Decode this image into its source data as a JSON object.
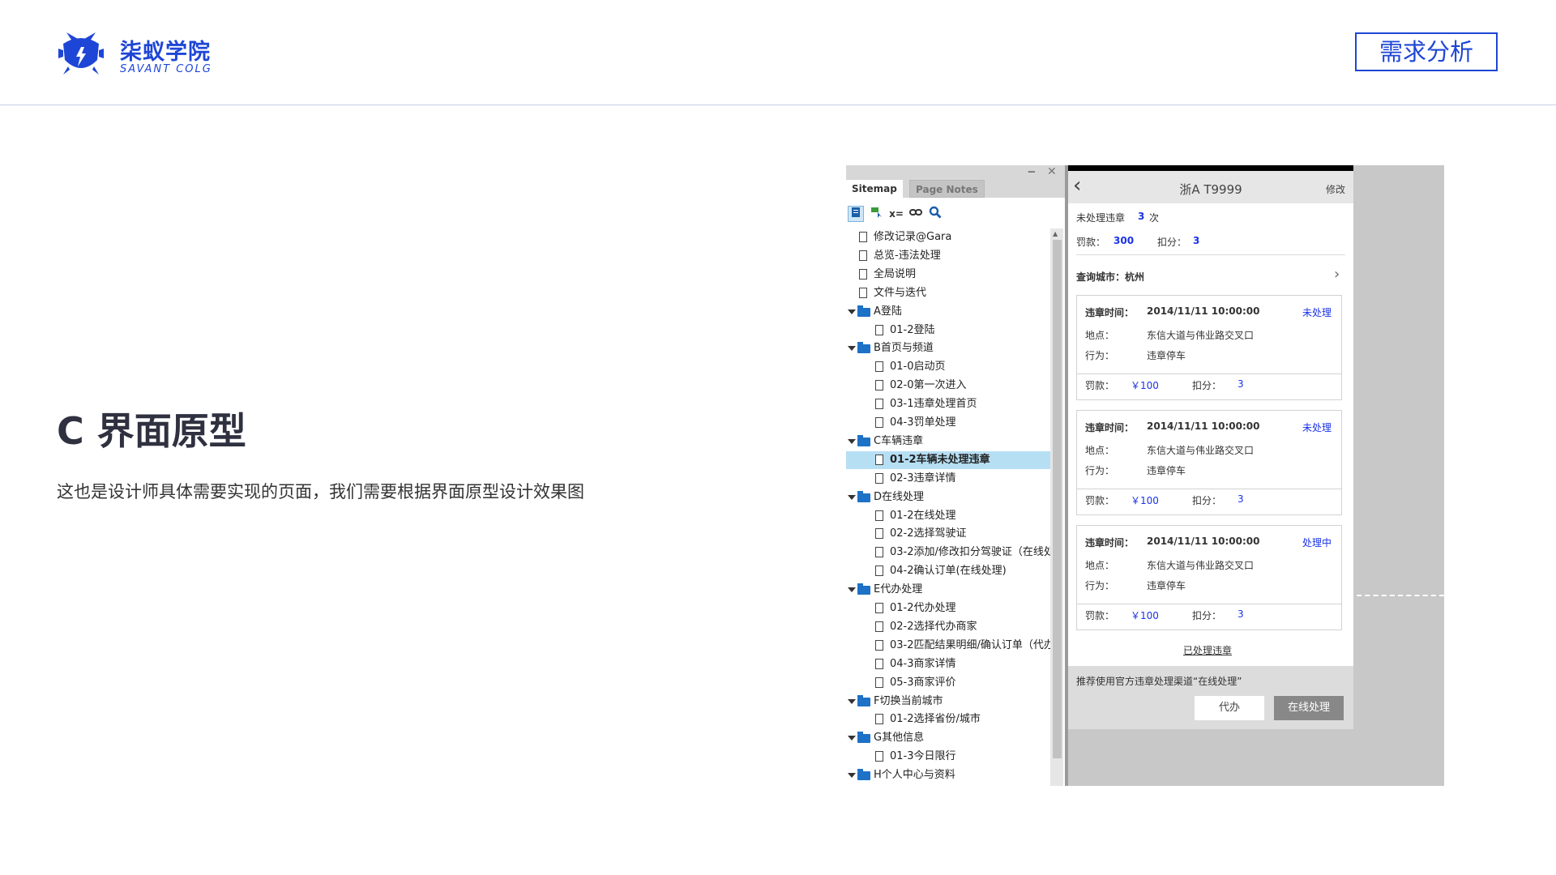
{
  "brand": {
    "name_cn": "柒蚁学院",
    "name_en": "SAVANT COLG",
    "color": "#1e46d6"
  },
  "header": {
    "tag": "需求分析"
  },
  "section": {
    "title": "C 界面原型",
    "subtitle": "这也是设计师具体需要实现的页面，我们需要根据界面原型设计效果图"
  },
  "sitemap": {
    "tabs": [
      "Sitemap",
      "Page Notes"
    ],
    "window_buttons": [
      "‒",
      "✕"
    ],
    "tools": [
      "page-icon",
      "flow-icon",
      "x= variables-icon",
      "link-icon",
      "search-icon"
    ],
    "tool_glyph_variables": "x=",
    "items": [
      {
        "label": "修改记录@Gara",
        "type": "page",
        "level": 0
      },
      {
        "label": "总览-违法处理",
        "type": "page",
        "level": 0
      },
      {
        "label": "全局说明",
        "type": "page",
        "level": 0
      },
      {
        "label": "文件与迭代",
        "type": "page",
        "level": 0
      },
      {
        "label": "A登陆",
        "type": "folder",
        "level": 0
      },
      {
        "label": "01-2登陆",
        "type": "page",
        "level": 1
      },
      {
        "label": "B首页与频道",
        "type": "folder",
        "level": 0
      },
      {
        "label": "01-0启动页",
        "type": "page",
        "level": 1
      },
      {
        "label": "02-0第一次进入",
        "type": "page",
        "level": 1
      },
      {
        "label": "03-1违章处理首页",
        "type": "page",
        "level": 1
      },
      {
        "label": "04-3罚单处理",
        "type": "page",
        "level": 1
      },
      {
        "label": "C车辆违章",
        "type": "folder",
        "level": 0
      },
      {
        "label": "01-2车辆未处理违章",
        "type": "page",
        "level": 1,
        "selected": true
      },
      {
        "label": "02-3违章详情",
        "type": "page",
        "level": 1
      },
      {
        "label": "D在线处理",
        "type": "folder",
        "level": 0
      },
      {
        "label": "01-2在线处理",
        "type": "page",
        "level": 1
      },
      {
        "label": "02-2选择驾驶证",
        "type": "page",
        "level": 1
      },
      {
        "label": "03-2添加/修改扣分驾驶证（在线处",
        "type": "page",
        "level": 1
      },
      {
        "label": "04-2确认订单(在线处理)",
        "type": "page",
        "level": 1
      },
      {
        "label": "E代办处理",
        "type": "folder",
        "level": 0
      },
      {
        "label": "01-2代办处理",
        "type": "page",
        "level": 1
      },
      {
        "label": "02-2选择代办商家",
        "type": "page",
        "level": 1
      },
      {
        "label": "03-2匹配结果明细/确认订单（代办",
        "type": "page",
        "level": 1
      },
      {
        "label": "04-3商家详情",
        "type": "page",
        "level": 1
      },
      {
        "label": "05-3商家评价",
        "type": "page",
        "level": 1
      },
      {
        "label": "F切换当前城市",
        "type": "folder",
        "level": 0
      },
      {
        "label": "01-2选择省份/城市",
        "type": "page",
        "level": 1
      },
      {
        "label": "G其他信息",
        "type": "folder",
        "level": 0
      },
      {
        "label": "01-3今日限行",
        "type": "page",
        "level": 1
      },
      {
        "label": "H个人中心与资料",
        "type": "folder",
        "level": 0
      }
    ]
  },
  "phone": {
    "nav": {
      "back": "‹",
      "title": "浙A T9999",
      "edit": "修改"
    },
    "summary": {
      "unhandled_label": "未处理违章",
      "unhandled_count": "3",
      "unhandled_unit": "次",
      "fine_label": "罚款：",
      "fine_value": "300",
      "points_label": "扣分：",
      "points_value": "3"
    },
    "city": {
      "label": "查询城市：杭州",
      "chevron": "›"
    },
    "records": [
      {
        "time_label": "违章时间：",
        "time": "2014/11/11   10:00:00",
        "status": "未处理",
        "place_label": "地点：",
        "place": "东信大道与伟业路交叉口",
        "action_label": "行为：",
        "action": "违章停车",
        "fine_label": "罚款：",
        "fine": "￥100",
        "points_label": "扣分：",
        "points": "3"
      },
      {
        "time_label": "违章时间：",
        "time": "2014/11/11   10:00:00",
        "status": "未处理",
        "place_label": "地点：",
        "place": "东信大道与伟业路交叉口",
        "action_label": "行为：",
        "action": "违章停车",
        "fine_label": "罚款：",
        "fine": "￥100",
        "points_label": "扣分：",
        "points": "3"
      },
      {
        "time_label": "违章时间：",
        "time": "2014/11/11   10:00:00",
        "status": "处理中",
        "place_label": "地点：",
        "place": "东信大道与伟业路交叉口",
        "action_label": "行为：",
        "action": "违章停车",
        "fine_label": "罚款：",
        "fine": "￥100",
        "points_label": "扣分：",
        "points": "3"
      }
    ],
    "handled_link": "已处理违章",
    "recommend": "推荐使用官方违章处理渠道“在线处理”",
    "buttons": {
      "agent": "代办",
      "online": "在线处理"
    }
  }
}
